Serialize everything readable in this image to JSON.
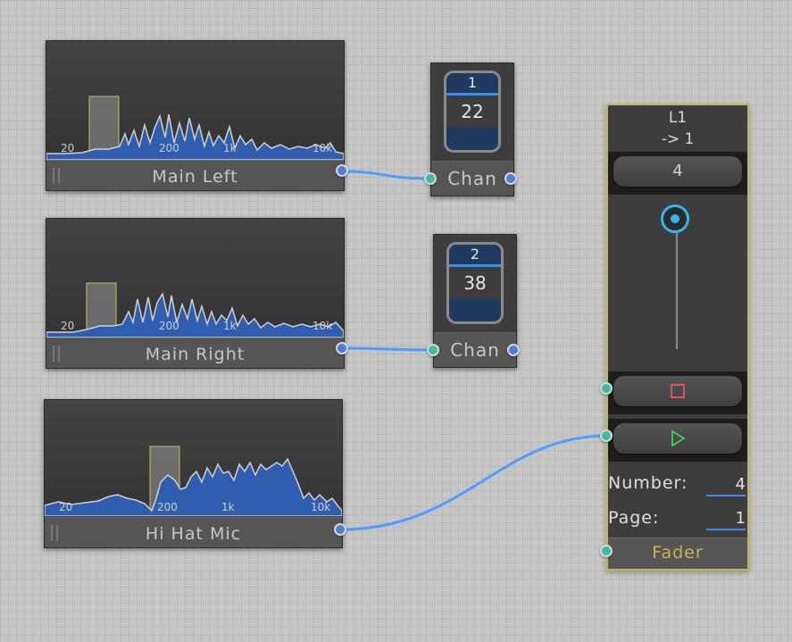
{
  "spectrum_nodes": [
    {
      "title": "Main Left",
      "ticks": [
        "20",
        "200",
        "1k",
        "10k"
      ]
    },
    {
      "title": "Main Right",
      "ticks": [
        "20",
        "200",
        "1k",
        "10k"
      ]
    },
    {
      "title": "Hi Hat Mic",
      "ticks": [
        "20",
        "200",
        "1k",
        "10k"
      ]
    }
  ],
  "chan_nodes": [
    {
      "number": "1",
      "value": "22",
      "label": "Chan"
    },
    {
      "number": "2",
      "value": "38",
      "label": "Chan"
    }
  ],
  "fader": {
    "title_line1": "L1",
    "title_line2": "-> 1",
    "display_value": "4",
    "number_label": "Number:",
    "number_value": "4",
    "page_label": "Page:",
    "page_value": "1",
    "label": "Fader"
  },
  "colors": {
    "wire": "#4f9cff",
    "spectrum_fill": "#2f5eb0",
    "spectrum_line": "#d0d0d0",
    "band_highlight": "#c9c44f",
    "fader_border": "#bcb56b",
    "stop_icon": "#e85a5a",
    "play_icon": "#3fcf5f",
    "knob": "#2fb8e8"
  },
  "icons": {
    "stop": "square-stop-icon",
    "play": "play-triangle-icon",
    "knob": "fader-knob-icon"
  }
}
